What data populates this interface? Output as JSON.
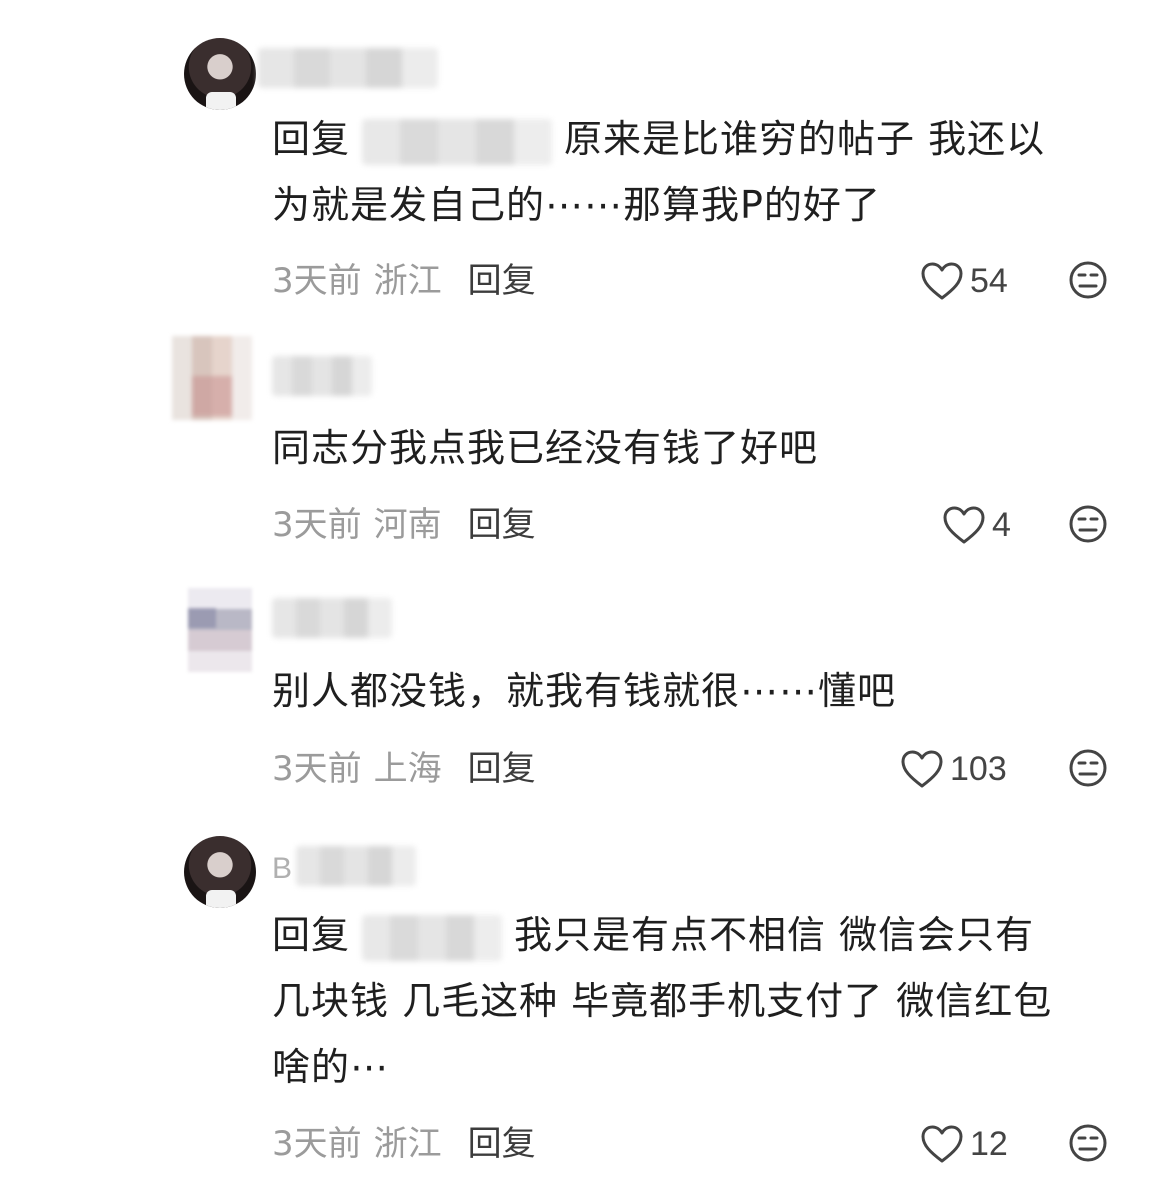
{
  "comments": [
    {
      "username_prefix": "",
      "reply_prefix": "回复",
      "text_line1": "原来是比谁穷的帖子 我还以",
      "text_line2": "为就是发自己的⋯⋯那算我P的好了",
      "text_line3": "",
      "time": "3天前",
      "location": "浙江",
      "reply_label": "回复",
      "likes": "54"
    },
    {
      "username_prefix": "",
      "reply_prefix": "",
      "text_line1": "同志分我点我已经没有钱了好吧",
      "time": "3天前",
      "location": "河南",
      "reply_label": "回复",
      "likes": "4"
    },
    {
      "username_prefix": "",
      "reply_prefix": "",
      "text_line1": "别人都没钱，就我有钱就很⋯⋯懂吧",
      "time": "3天前",
      "location": "上海",
      "reply_label": "回复",
      "likes": "103"
    },
    {
      "username_prefix": "B",
      "reply_prefix": "回复",
      "text_line1": "我只是有点不相信 微信会只有",
      "text_line2": "几块钱 几毛这种 毕竟都手机支付了 微信红包",
      "text_line3": "啥的⋯",
      "time": "3天前",
      "location": "浙江",
      "reply_label": "回复",
      "likes": "12"
    }
  ],
  "icons": {
    "like": "heart-outline-icon",
    "dislike": "unhappy-face-icon"
  },
  "colors": {
    "text": "#1f1f1f",
    "meta": "#9b9b9b",
    "icon": "#444444"
  }
}
